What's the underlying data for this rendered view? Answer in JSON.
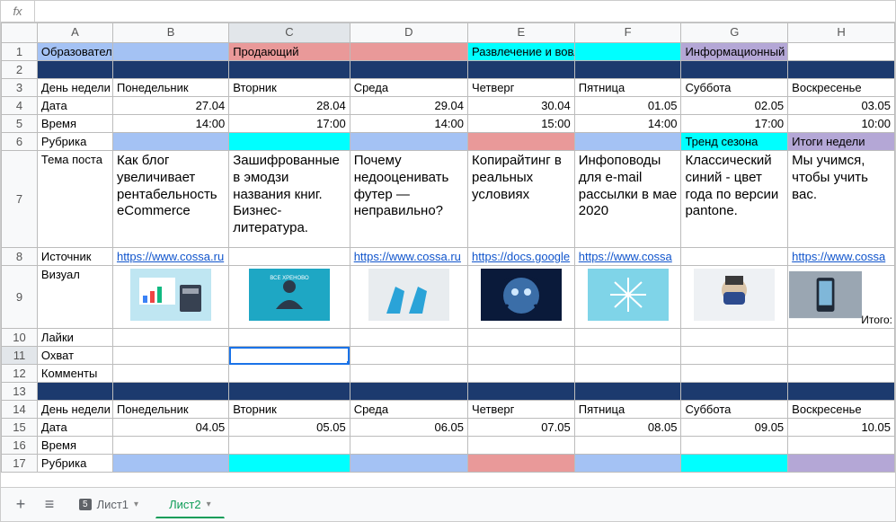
{
  "fx": {
    "label": "fx",
    "value": ""
  },
  "columns": [
    "A",
    "B",
    "C",
    "D",
    "E",
    "F",
    "G",
    "H"
  ],
  "rows": [
    "1",
    "2",
    "3",
    "4",
    "5",
    "6",
    "7",
    "8",
    "9",
    "10",
    "11",
    "12",
    "13",
    "14",
    "15",
    "16",
    "17"
  ],
  "r1": {
    "A": "Образовательный пост",
    "C": "Продающий",
    "E": "Развлечение и вовлечение",
    "G": "Информационный"
  },
  "r3": {
    "A": "День недели",
    "B": "Понедельник",
    "C": "Вторник",
    "D": "Среда",
    "E": "Четверг",
    "F": "Пятница",
    "G": "Суббота",
    "H": "Воскресенье"
  },
  "r4": {
    "A": "Дата",
    "B": "27.04",
    "C": "28.04",
    "D": "29.04",
    "E": "30.04",
    "F": "01.05",
    "G": "02.05",
    "H": "03.05"
  },
  "r5": {
    "A": "Время",
    "B": "14:00",
    "C": "17:00",
    "D": "14:00",
    "E": "15:00",
    "F": "14:00",
    "G": "17:00",
    "H": "10:00"
  },
  "r6": {
    "A": "Рубрика",
    "G": "Тренд сезона",
    "H": "Итоги недели"
  },
  "r7": {
    "A": "Тема поста",
    "B": "Как блог увеличивает рентабельность eCommerce",
    "C": "Зашифрованные в эмодзи названия книг. Бизнес-литература.",
    "D": "Почему недооценивать футер — неправильно?",
    "E": "Копирайтинг в реальных условиях",
    "F": "Инфоповоды для e-mail рассылки в мае 2020",
    "G": "Классический синий - цвет года по версии pantone.",
    "H": "Мы учимся, чтобы учить вас."
  },
  "r8": {
    "A": "Источник",
    "B": "https://www.cossa.ru",
    "D": "https://www.cossa.ru",
    "E": "https://docs.google",
    "F": "https://www.cossa",
    "H": "https://www.cossa"
  },
  "r9": {
    "A": "Визуал",
    "H_side": "Итого:"
  },
  "r10": {
    "A": "Лайки"
  },
  "r11": {
    "A": "Охват"
  },
  "r12": {
    "A": "Комменты"
  },
  "r14": {
    "A": "День недели",
    "B": "Понедельник",
    "C": "Вторник",
    "D": "Среда",
    "E": "Четверг",
    "F": "Пятница",
    "G": "Суббота",
    "H": "Воскресенье"
  },
  "r15": {
    "A": "Дата",
    "B": "04.05",
    "C": "05.05",
    "D": "06.05",
    "E": "07.05",
    "F": "08.05",
    "G": "09.05",
    "H": "10.05"
  },
  "r16": {
    "A": "Время"
  },
  "r17": {
    "A": "Рубрика"
  },
  "sheets": {
    "add": "+",
    "all": "≡",
    "tab1": "Лист1",
    "tab2": "Лист2",
    "badge": "5"
  },
  "icons": {
    "chart": "chart-icon",
    "meditate": "meditate-icon",
    "shoes": "shoes-icon",
    "tiger": "tiger-icon",
    "snow": "snowflake-icon",
    "mask": "mask-icon",
    "phone": "phone-icon"
  }
}
